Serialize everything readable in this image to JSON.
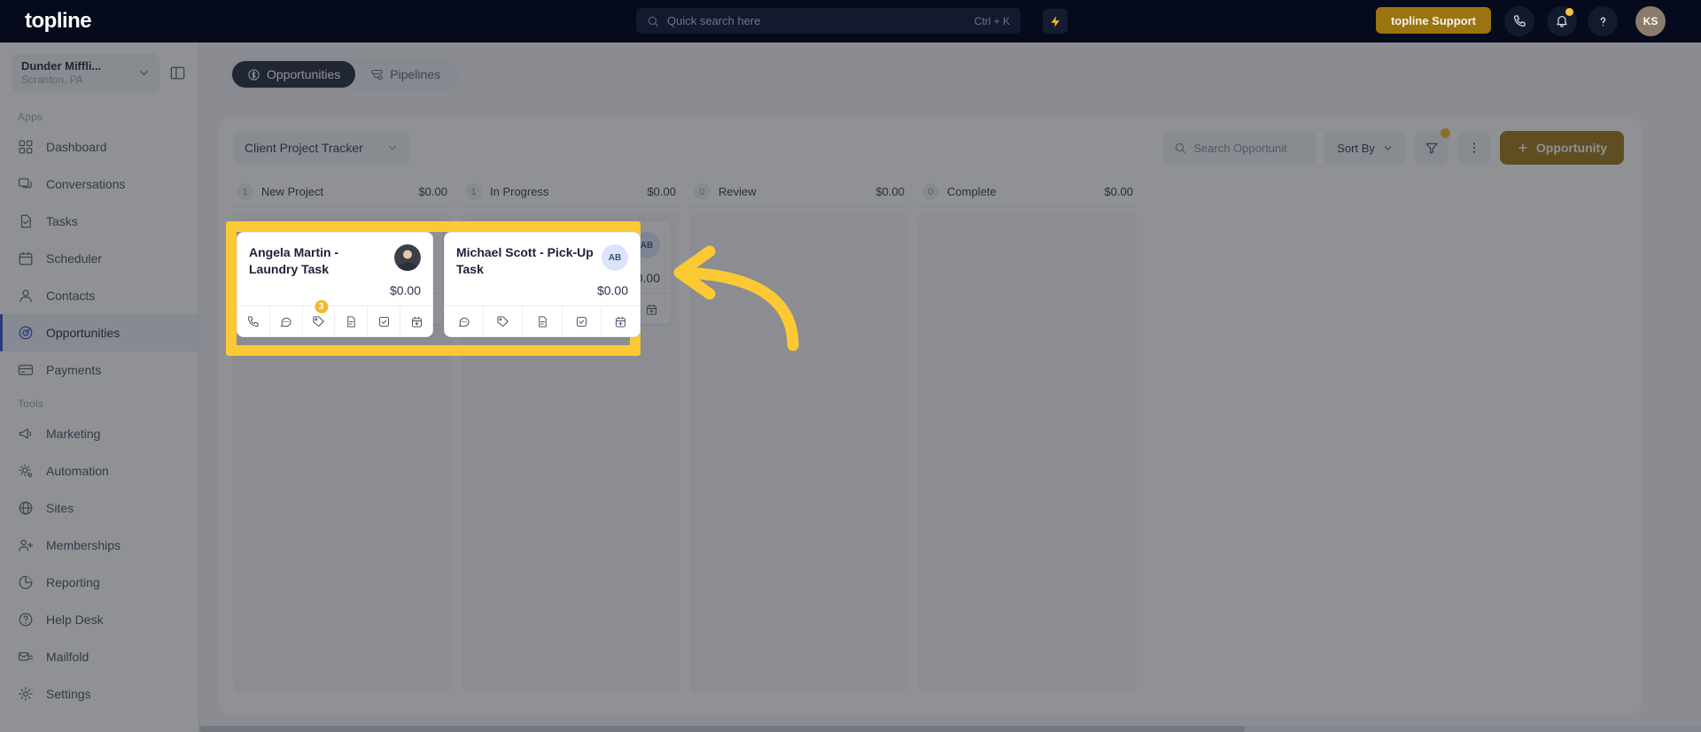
{
  "header": {
    "logo": "topline",
    "search_placeholder": "Quick search here",
    "search_shortcut": "Ctrl + K",
    "support_label": "topline Support",
    "avatar_initials": "KS",
    "icons": {
      "search": "search-icon",
      "bolt": "lightning-bolt-icon",
      "phone": "phone-icon",
      "bell": "bell-icon",
      "help": "question-mark-icon"
    }
  },
  "sidebar": {
    "location_name": "Dunder Miffli...",
    "location_sub": "Scranton, PA",
    "groups": [
      {
        "label": "Apps",
        "items": [
          {
            "label": "Dashboard",
            "icon": "dashboard-icon",
            "active": false
          },
          {
            "label": "Conversations",
            "icon": "chat-icon",
            "active": false
          },
          {
            "label": "Tasks",
            "icon": "task-icon",
            "active": false
          },
          {
            "label": "Scheduler",
            "icon": "calendar-icon",
            "active": false
          },
          {
            "label": "Contacts",
            "icon": "person-icon",
            "active": false
          },
          {
            "label": "Opportunities",
            "icon": "target-icon",
            "active": true
          },
          {
            "label": "Payments",
            "icon": "card-icon",
            "active": false
          }
        ]
      },
      {
        "label": "Tools",
        "items": [
          {
            "label": "Marketing",
            "icon": "megaphone-icon",
            "active": false
          },
          {
            "label": "Automation",
            "icon": "gear-icon",
            "active": false
          },
          {
            "label": "Sites",
            "icon": "globe-icon",
            "active": false
          },
          {
            "label": "Memberships",
            "icon": "users-icon",
            "active": false
          },
          {
            "label": "Reporting",
            "icon": "pie-chart-icon",
            "active": false
          },
          {
            "label": "Help Desk",
            "icon": "help-circle-icon",
            "active": false
          },
          {
            "label": "Mailfold",
            "icon": "mail-icon",
            "active": false
          },
          {
            "label": "Settings",
            "icon": "settings-gear-icon",
            "active": false
          }
        ]
      }
    ]
  },
  "tabs": [
    {
      "label": "Opportunities",
      "icon": "dollar-circle-icon",
      "active": true
    },
    {
      "label": "Pipelines",
      "icon": "pipeline-icon",
      "active": false
    }
  ],
  "toolbar": {
    "pipeline_name": "Client Project Tracker",
    "search_placeholder": "Search Opportunit",
    "sort_label": "Sort By",
    "add_label": "Opportunity",
    "filter_icon": "filter-icon",
    "more_icon": "kebab-menu-icon",
    "has_filter_badge": true
  },
  "board": {
    "columns": [
      {
        "title": "New Project",
        "count": "1",
        "amount": "$0.00",
        "cards": [
          {
            "title": "Angela Martin - Laundry Task",
            "amount": "$0.00",
            "avatar_type": "photo",
            "avatar_initials": "",
            "actions": [
              {
                "icon": "phone-icon",
                "badge": ""
              },
              {
                "icon": "message-icon",
                "badge": ""
              },
              {
                "icon": "tag-icon",
                "badge": "3"
              },
              {
                "icon": "document-icon",
                "badge": ""
              },
              {
                "icon": "checkbox-icon",
                "badge": ""
              },
              {
                "icon": "calendar-add-icon",
                "badge": ""
              }
            ]
          }
        ]
      },
      {
        "title": "In Progress",
        "count": "1",
        "amount": "$0.00",
        "cards": [
          {
            "title": "Michael Scott - Pick-Up Task",
            "amount": "$0.00",
            "avatar_type": "initials",
            "avatar_initials": "AB",
            "actions": [
              {
                "icon": "message-icon",
                "badge": ""
              },
              {
                "icon": "tag-icon",
                "badge": ""
              },
              {
                "icon": "document-icon",
                "badge": ""
              },
              {
                "icon": "checkbox-icon",
                "badge": ""
              },
              {
                "icon": "calendar-add-icon",
                "badge": ""
              }
            ]
          }
        ]
      },
      {
        "title": "Review",
        "count": "0",
        "amount": "$0.00",
        "cards": []
      },
      {
        "title": "Complete",
        "count": "0",
        "amount": "$0.00",
        "cards": []
      }
    ]
  },
  "annotation": {
    "highlight_color": "#fcc934",
    "arrow_color": "#fcc934",
    "arrow_direction": "left"
  }
}
